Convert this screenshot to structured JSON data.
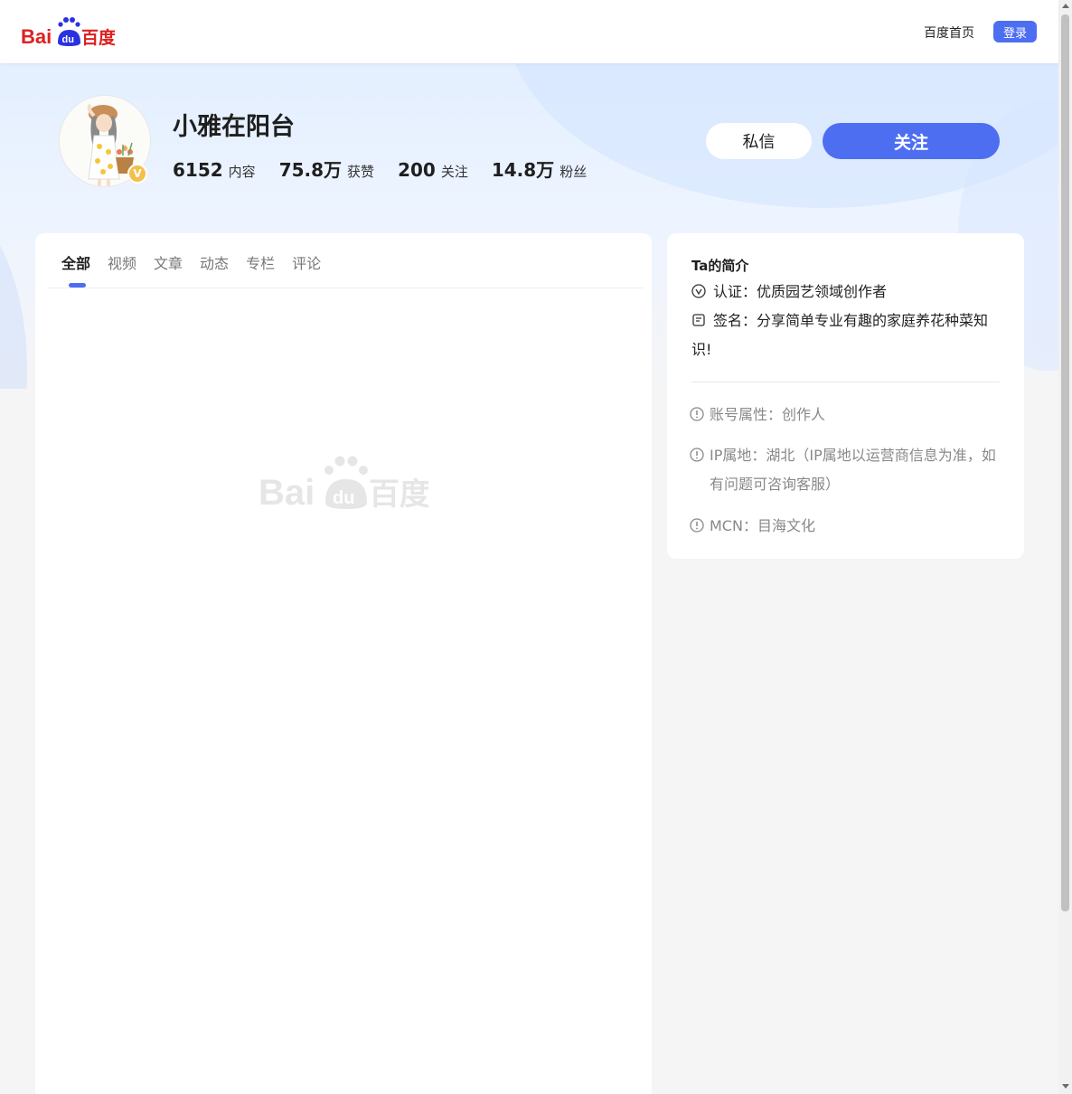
{
  "header": {
    "logo_text": "Bai百度",
    "home_link": "百度首页",
    "login_label": "登录"
  },
  "profile": {
    "name": "小雅在阳台",
    "verified_badge": "V",
    "stats": [
      {
        "value": "6152",
        "label": "内容"
      },
      {
        "value": "75.8万",
        "label": "获赞"
      },
      {
        "value": "200",
        "label": "关注"
      },
      {
        "value": "14.8万",
        "label": "粉丝"
      }
    ],
    "message_label": "私信",
    "follow_label": "关注"
  },
  "tabs": [
    "全部",
    "视频",
    "文章",
    "动态",
    "专栏",
    "评论"
  ],
  "active_tab": "全部",
  "intro": {
    "title": "Ta的简介",
    "certification": "认证：优质园艺领域创作者",
    "signature": "签名：分享简单专业有趣的家庭养花种菜知识!",
    "account_type": "账号属性：创作人",
    "ip_location": "IP属地：湖北（IP属地以运营商信息为准，如有问题可咨询客服）",
    "mcn": "MCN：目海文化"
  },
  "colors": {
    "accent": "#4e6ef2",
    "logo_red": "#de2020",
    "logo_blue": "#2932e1",
    "badge": "#f5c04a"
  }
}
